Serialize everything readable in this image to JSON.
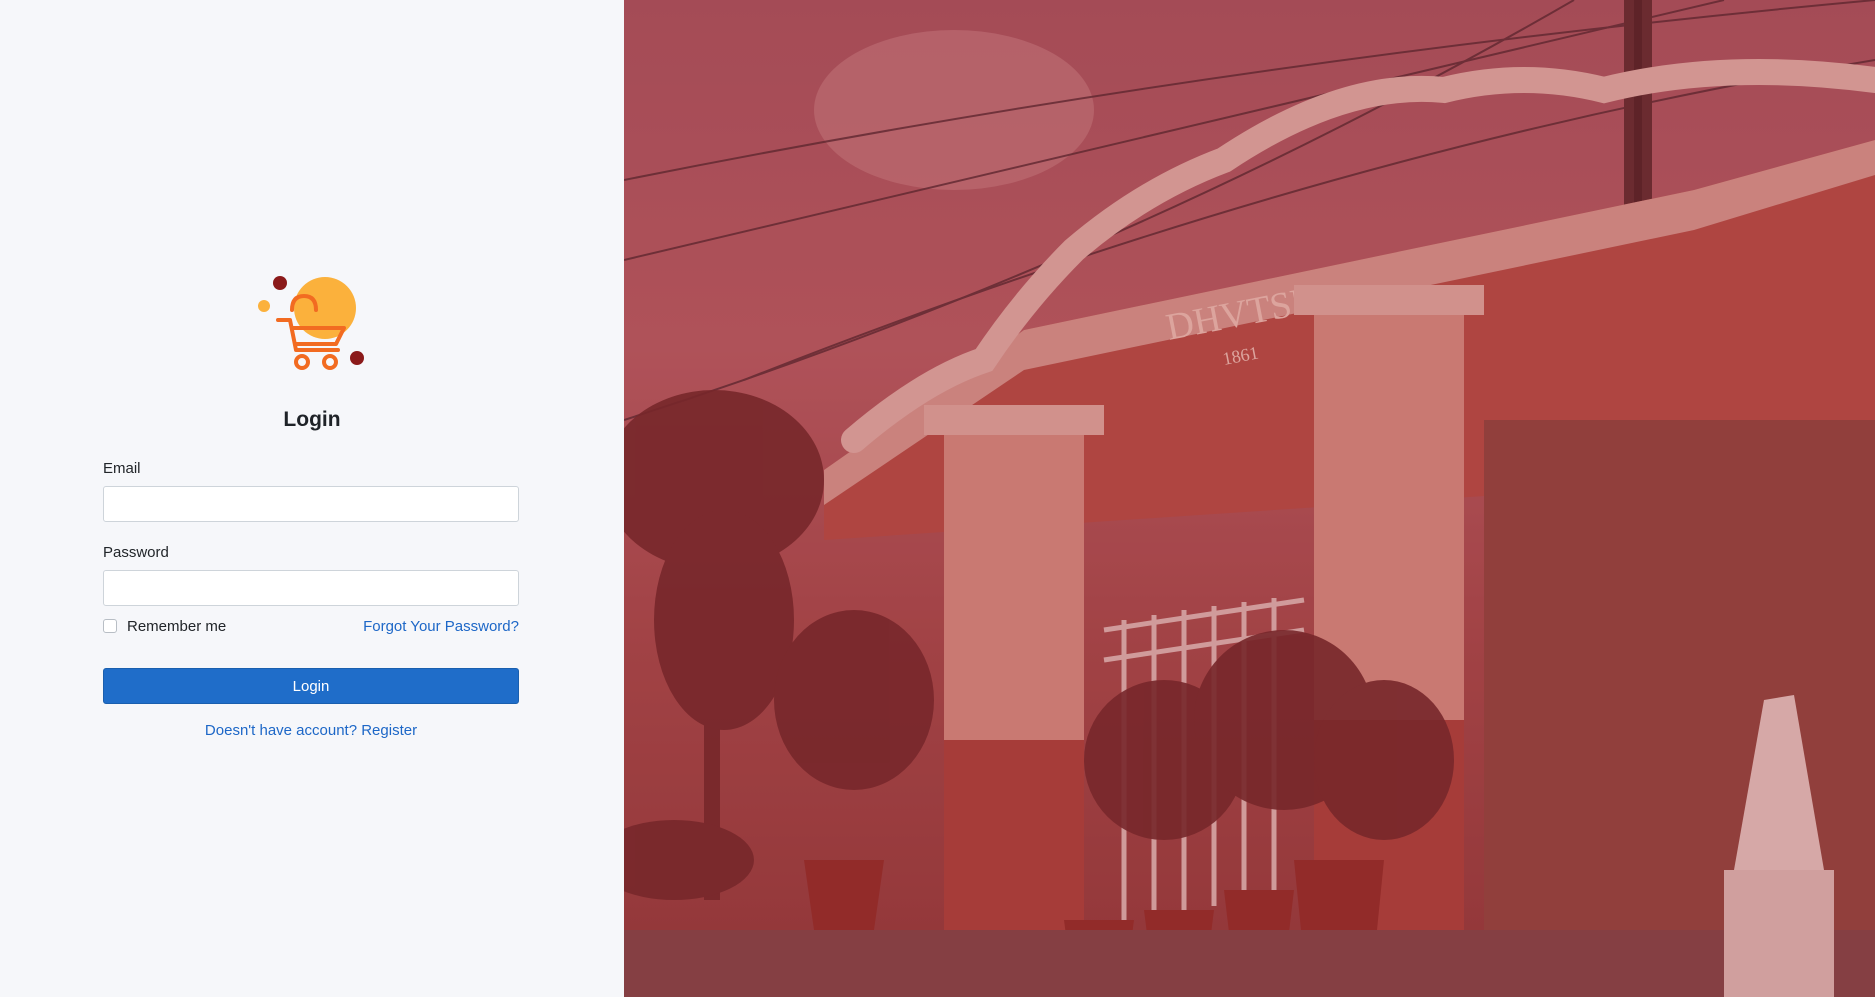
{
  "login": {
    "title": "Login",
    "email_label": "Email",
    "email_value": "",
    "password_label": "Password",
    "password_value": "",
    "remember_label": "Remember me",
    "forgot_link": "Forgot Your Password?",
    "login_button": "Login",
    "register_link": "Doesn't have account? Register"
  },
  "banner": {
    "sign_text": "DHVTSU",
    "sign_year": "1861"
  },
  "colors": {
    "primary": "#1f6dc9",
    "link": "#1d67c7",
    "logo_orange": "#f26b21",
    "logo_yellow": "#fbb13c",
    "logo_maroon": "#8b1a1a"
  },
  "icons": {
    "logo": "shopping-cart-icon"
  }
}
